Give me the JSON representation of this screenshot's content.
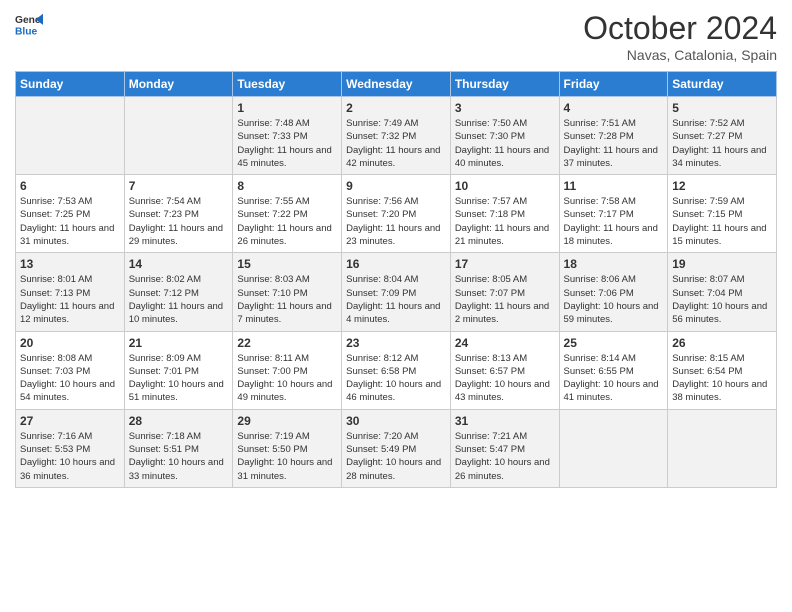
{
  "logo": {
    "text_general": "General",
    "text_blue": "Blue"
  },
  "header": {
    "month": "October 2024",
    "location": "Navas, Catalonia, Spain"
  },
  "days_of_week": [
    "Sunday",
    "Monday",
    "Tuesday",
    "Wednesday",
    "Thursday",
    "Friday",
    "Saturday"
  ],
  "weeks": [
    [
      {
        "day": "",
        "info": ""
      },
      {
        "day": "",
        "info": ""
      },
      {
        "day": "1",
        "info": "Sunrise: 7:48 AM\nSunset: 7:33 PM\nDaylight: 11 hours and 45 minutes."
      },
      {
        "day": "2",
        "info": "Sunrise: 7:49 AM\nSunset: 7:32 PM\nDaylight: 11 hours and 42 minutes."
      },
      {
        "day": "3",
        "info": "Sunrise: 7:50 AM\nSunset: 7:30 PM\nDaylight: 11 hours and 40 minutes."
      },
      {
        "day": "4",
        "info": "Sunrise: 7:51 AM\nSunset: 7:28 PM\nDaylight: 11 hours and 37 minutes."
      },
      {
        "day": "5",
        "info": "Sunrise: 7:52 AM\nSunset: 7:27 PM\nDaylight: 11 hours and 34 minutes."
      }
    ],
    [
      {
        "day": "6",
        "info": "Sunrise: 7:53 AM\nSunset: 7:25 PM\nDaylight: 11 hours and 31 minutes."
      },
      {
        "day": "7",
        "info": "Sunrise: 7:54 AM\nSunset: 7:23 PM\nDaylight: 11 hours and 29 minutes."
      },
      {
        "day": "8",
        "info": "Sunrise: 7:55 AM\nSunset: 7:22 PM\nDaylight: 11 hours and 26 minutes."
      },
      {
        "day": "9",
        "info": "Sunrise: 7:56 AM\nSunset: 7:20 PM\nDaylight: 11 hours and 23 minutes."
      },
      {
        "day": "10",
        "info": "Sunrise: 7:57 AM\nSunset: 7:18 PM\nDaylight: 11 hours and 21 minutes."
      },
      {
        "day": "11",
        "info": "Sunrise: 7:58 AM\nSunset: 7:17 PM\nDaylight: 11 hours and 18 minutes."
      },
      {
        "day": "12",
        "info": "Sunrise: 7:59 AM\nSunset: 7:15 PM\nDaylight: 11 hours and 15 minutes."
      }
    ],
    [
      {
        "day": "13",
        "info": "Sunrise: 8:01 AM\nSunset: 7:13 PM\nDaylight: 11 hours and 12 minutes."
      },
      {
        "day": "14",
        "info": "Sunrise: 8:02 AM\nSunset: 7:12 PM\nDaylight: 11 hours and 10 minutes."
      },
      {
        "day": "15",
        "info": "Sunrise: 8:03 AM\nSunset: 7:10 PM\nDaylight: 11 hours and 7 minutes."
      },
      {
        "day": "16",
        "info": "Sunrise: 8:04 AM\nSunset: 7:09 PM\nDaylight: 11 hours and 4 minutes."
      },
      {
        "day": "17",
        "info": "Sunrise: 8:05 AM\nSunset: 7:07 PM\nDaylight: 11 hours and 2 minutes."
      },
      {
        "day": "18",
        "info": "Sunrise: 8:06 AM\nSunset: 7:06 PM\nDaylight: 10 hours and 59 minutes."
      },
      {
        "day": "19",
        "info": "Sunrise: 8:07 AM\nSunset: 7:04 PM\nDaylight: 10 hours and 56 minutes."
      }
    ],
    [
      {
        "day": "20",
        "info": "Sunrise: 8:08 AM\nSunset: 7:03 PM\nDaylight: 10 hours and 54 minutes."
      },
      {
        "day": "21",
        "info": "Sunrise: 8:09 AM\nSunset: 7:01 PM\nDaylight: 10 hours and 51 minutes."
      },
      {
        "day": "22",
        "info": "Sunrise: 8:11 AM\nSunset: 7:00 PM\nDaylight: 10 hours and 49 minutes."
      },
      {
        "day": "23",
        "info": "Sunrise: 8:12 AM\nSunset: 6:58 PM\nDaylight: 10 hours and 46 minutes."
      },
      {
        "day": "24",
        "info": "Sunrise: 8:13 AM\nSunset: 6:57 PM\nDaylight: 10 hours and 43 minutes."
      },
      {
        "day": "25",
        "info": "Sunrise: 8:14 AM\nSunset: 6:55 PM\nDaylight: 10 hours and 41 minutes."
      },
      {
        "day": "26",
        "info": "Sunrise: 8:15 AM\nSunset: 6:54 PM\nDaylight: 10 hours and 38 minutes."
      }
    ],
    [
      {
        "day": "27",
        "info": "Sunrise: 7:16 AM\nSunset: 5:53 PM\nDaylight: 10 hours and 36 minutes."
      },
      {
        "day": "28",
        "info": "Sunrise: 7:18 AM\nSunset: 5:51 PM\nDaylight: 10 hours and 33 minutes."
      },
      {
        "day": "29",
        "info": "Sunrise: 7:19 AM\nSunset: 5:50 PM\nDaylight: 10 hours and 31 minutes."
      },
      {
        "day": "30",
        "info": "Sunrise: 7:20 AM\nSunset: 5:49 PM\nDaylight: 10 hours and 28 minutes."
      },
      {
        "day": "31",
        "info": "Sunrise: 7:21 AM\nSunset: 5:47 PM\nDaylight: 10 hours and 26 minutes."
      },
      {
        "day": "",
        "info": ""
      },
      {
        "day": "",
        "info": ""
      }
    ]
  ]
}
